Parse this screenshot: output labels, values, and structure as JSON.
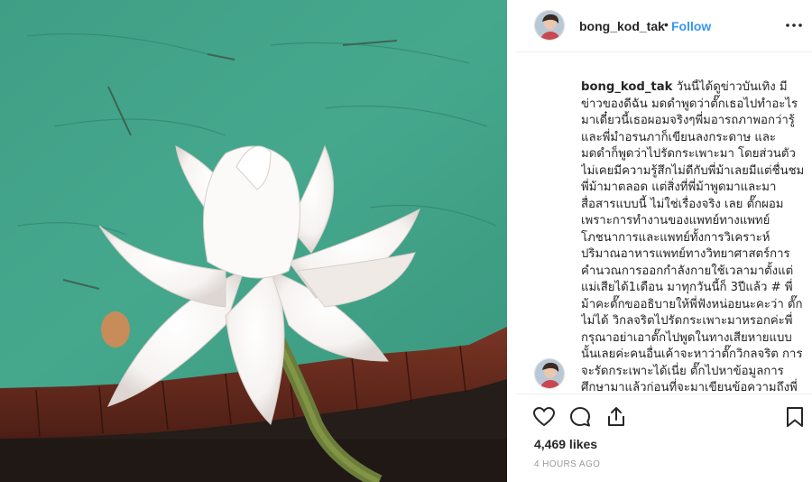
{
  "post": {
    "image_alt": "white water lily on a giant lily pad",
    "author": {
      "username": "bong_kod_tak"
    },
    "follow_label": "Follow",
    "separator": "•",
    "caption": "วันนี้ได้ดูข่าวบันเทิง มีข่าวของดีฉัน มดดำพูดว่าตั๊กเธอไปทำอะไรมาเดี๋ยวนี้เธอผอมจริงๆพี่มอารถภาพอกว่ารู้และพี่มำอรนภาก็เขียนลงกระดาษ และมดดำก็พูดว่าไปรัดกระเพาะมา โดยส่วนตัวไม่เคยมีความรู้สึกไม่ดีกับพี่ม้าเลยมีแต่ชื่นชมพี่ม้ามาตลอด แต่สิ่งที่พี่ม้าพูดมาและมาสื่อสารแบบนี้ ไม่ใช่เรื่องจริง เลย ตั๊กผอมเพราะการทำงานของแพทย์ทางแพทย์โภชนาการและแพทย์ทั้งการวิเคราะห์ปริมาณอาหารแพทย์ทางวิทยาศาสตร์การคำนวณการออกกำลังกายใช้เวลามาตั้งแต่แม่เสียได้1เดือน มาทุกวันนี้ก็ 3ปีแล้ว # พี่ม้าคะตั๊กขออธิบายให้พี่ฟังหน่อยนะคะว่า ตั๊กไม่ได้ วิกลจริตไปรัดกระเพาะมาหรอกค่ะพี่ กรุณาอย่าเอาตั๊กไปพูดในทางเสียหายแบบนั้นเลยค่ะคนอื่นเค้าจะหาว่าตั๊กวิกลจริต การจะรัดกระเพาะได้เนี่ย ตั๊กไปหาข้อมูลการศึกษามาแล้วก่อนที่จะมาเขียนข้อความถึงพี่ม้าตั๊กจะบอกพี่",
    "likes": "4,469 likes",
    "time": "4 HOURS AGO"
  },
  "icons": {
    "more": "more-options-icon",
    "like": "heart-icon",
    "comment": "comment-icon",
    "share": "share-icon",
    "save": "bookmark-icon"
  },
  "colors": {
    "link_blue": "#3897f0",
    "text": "#262626",
    "muted": "#999999",
    "border": "#efefef",
    "water": "#3fa58b",
    "pad_edge": "#6e2b1e"
  }
}
